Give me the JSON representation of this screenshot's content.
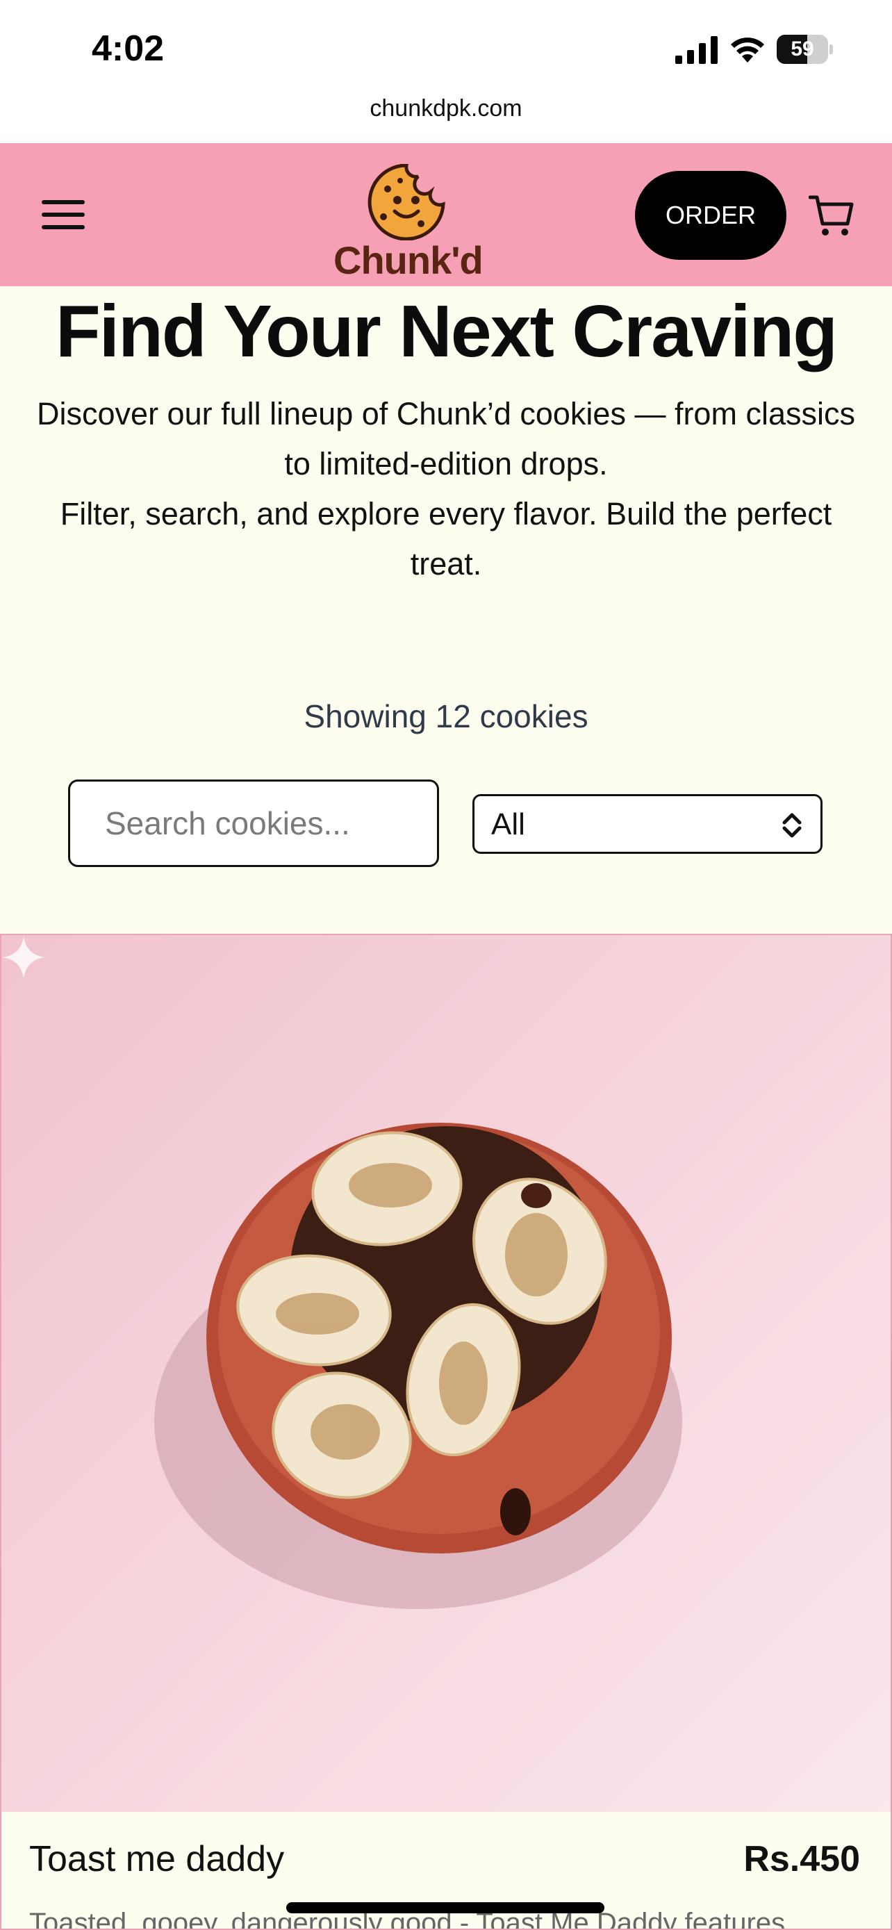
{
  "status_bar": {
    "time": "4:02",
    "battery_level": "59"
  },
  "browser": {
    "url": "chunkdpk.com"
  },
  "header": {
    "logo_text": "Chunk'd",
    "order_label": "ORDER",
    "menu_icon": "hamburger-menu-icon",
    "cart_icon": "shopping-cart-icon"
  },
  "hero": {
    "title": "Find Your Next Craving",
    "description_line1": "Discover our full lineup of Chunk’d cookies — from classics to limited-edition drops.",
    "description_line2": "Filter, search, and explore every flavor. Build the perfect treat."
  },
  "catalog": {
    "showing_text": "Showing 12 cookies",
    "search_placeholder": "Search cookies...",
    "search_value": "",
    "filter_selected": "All"
  },
  "products": [
    {
      "name": "Toast me daddy",
      "price": "Rs.450",
      "description": "Toasted, gooey, dangerously good - Toast Me Daddy features"
    }
  ],
  "colors": {
    "header_bg": "#f5a0b4",
    "page_bg": "#fdfdf0",
    "order_button": "#000000"
  }
}
